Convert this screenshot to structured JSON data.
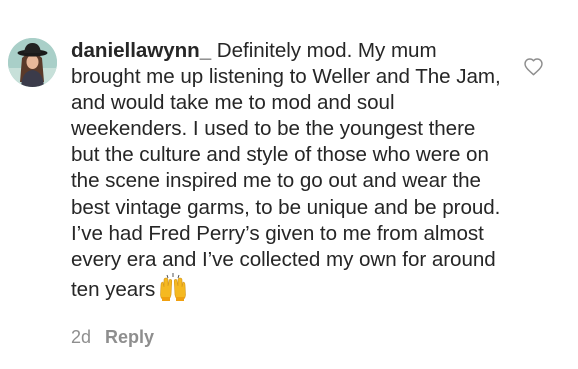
{
  "comment": {
    "username": "daniellawynn_",
    "text": "Definitely mod. My mum brought me up listening to Weller and The Jam, and would take me to mod and soul weekenders. I used to be the youngest there but the culture and style of those who were on the scene inspired me to go out and wear the best vintage garms, to be unique and be proud. I’ve had Fred Perry’s given to me from almost every era and I’ve collected my own for around ten years",
    "emoji": "raising-hands-emoji",
    "timestamp": "2d",
    "reply_label": "Reply",
    "icons": {
      "like": "heart-outline-icon",
      "avatar": "profile-avatar"
    },
    "colors": {
      "text": "#262626",
      "meta": "#8e8e8e",
      "avatar_bg": "#a9cfc8"
    }
  }
}
